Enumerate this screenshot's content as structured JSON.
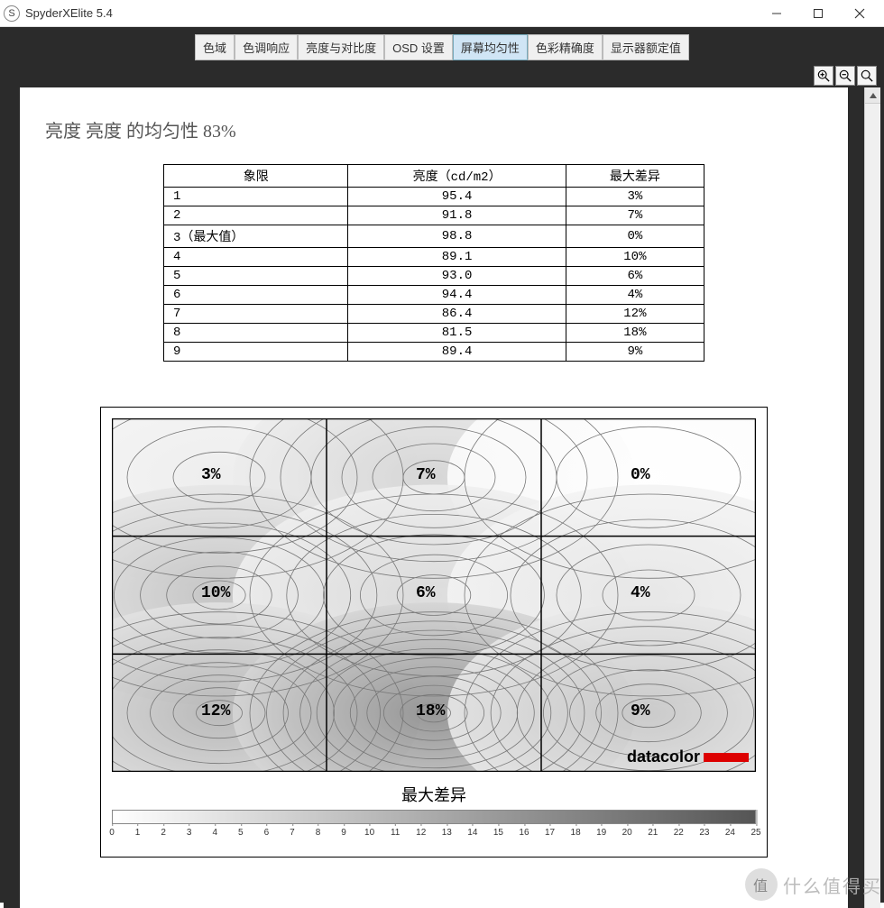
{
  "window": {
    "title": "SpyderXElite 5.4",
    "icon_letter": "S"
  },
  "tabs": [
    {
      "label": "色域",
      "id": "gamut"
    },
    {
      "label": "色调响应",
      "id": "tone"
    },
    {
      "label": "亮度与对比度",
      "id": "brightness"
    },
    {
      "label": "OSD 设置",
      "id": "osd"
    },
    {
      "label": "屏幕均匀性",
      "id": "uniformity",
      "active": true
    },
    {
      "label": "色彩精确度",
      "id": "accuracy"
    },
    {
      "label": "显示器额定值",
      "id": "rating"
    }
  ],
  "heading": "亮度 亮度 的均匀性 83%",
  "table": {
    "headers": [
      "象限",
      "亮度（cd/m2）",
      "最大差异"
    ],
    "rows": [
      [
        "1",
        "95.4",
        "3%"
      ],
      [
        "2",
        "91.8",
        "7%"
      ],
      [
        "3（最大值）",
        "98.8",
        "0%"
      ],
      [
        "4",
        "89.1",
        "10%"
      ],
      [
        "5",
        "93.0",
        "6%"
      ],
      [
        "6",
        "94.4",
        "4%"
      ],
      [
        "7",
        "86.4",
        "12%"
      ],
      [
        "8",
        "81.5",
        "18%"
      ],
      [
        "9",
        "89.4",
        "9%"
      ]
    ]
  },
  "chart_data": {
    "type": "heatmap",
    "title": "最大差异",
    "grid_labels": [
      "3%",
      "7%",
      "0%",
      "10%",
      "6%",
      "4%",
      "12%",
      "18%",
      "9%"
    ],
    "grid_values": [
      3,
      7,
      0,
      10,
      6,
      4,
      12,
      18,
      9
    ],
    "legend_ticks": [
      0,
      1,
      2,
      3,
      4,
      5,
      6,
      7,
      8,
      9,
      10,
      11,
      12,
      13,
      14,
      15,
      16,
      17,
      18,
      19,
      20,
      21,
      22,
      23,
      24,
      25
    ],
    "legend_range": [
      0,
      25
    ],
    "brand": "datacolor"
  },
  "watermark": {
    "icon": "值",
    "text": "什么值得买"
  }
}
